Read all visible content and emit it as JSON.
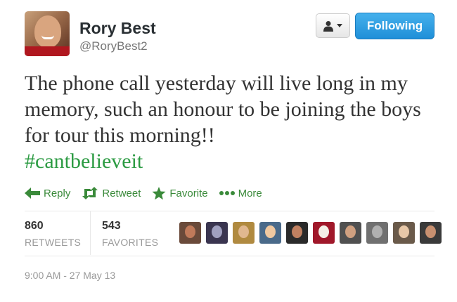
{
  "header": {
    "display_name": "Rory Best",
    "username": "@RoryBest2",
    "follow_label": "Following"
  },
  "tweet": {
    "text": "The phone call yesterday will live long in my memory, such an honour to be joining the boys for tour this morning!!",
    "hashtag": "#cantbelieveit"
  },
  "actions": {
    "reply": "Reply",
    "retweet": "Retweet",
    "favorite": "Favorite",
    "more": "More"
  },
  "stats": {
    "retweets_count": "860",
    "retweets_label": "RETWEETS",
    "favorites_count": "543",
    "favorites_label": "FAVORITES"
  },
  "favoriters": [
    {
      "bg": "#6a4a3a",
      "face": "#c07a5a"
    },
    {
      "bg": "#3a3550",
      "face": "#a0a0c0"
    },
    {
      "bg": "#b08a40",
      "face": "#e0b890"
    },
    {
      "bg": "#4a6a8a",
      "face": "#f0c8a0"
    },
    {
      "bg": "#2a2a2a",
      "face": "#c08060"
    },
    {
      "bg": "#a0182a",
      "face": "#f4f0e8"
    },
    {
      "bg": "#505050",
      "face": "#d0a080"
    },
    {
      "bg": "#707070",
      "face": "#b0b0b0"
    },
    {
      "bg": "#6a5a4a",
      "face": "#e8c8a8"
    },
    {
      "bg": "#3a3a3a",
      "face": "#c89070"
    }
  ],
  "timestamp": "9:00 AM - 27 May 13",
  "colors": {
    "action_green": "#3a8a3a",
    "hashtag_green": "#2c9b43",
    "follow_blue": "#1f8fd8"
  },
  "icons": {
    "reply": "reply-arrow-icon",
    "retweet": "retweet-icon",
    "favorite": "star-icon",
    "more": "more-dots-icon",
    "user_menu": "person-icon"
  }
}
